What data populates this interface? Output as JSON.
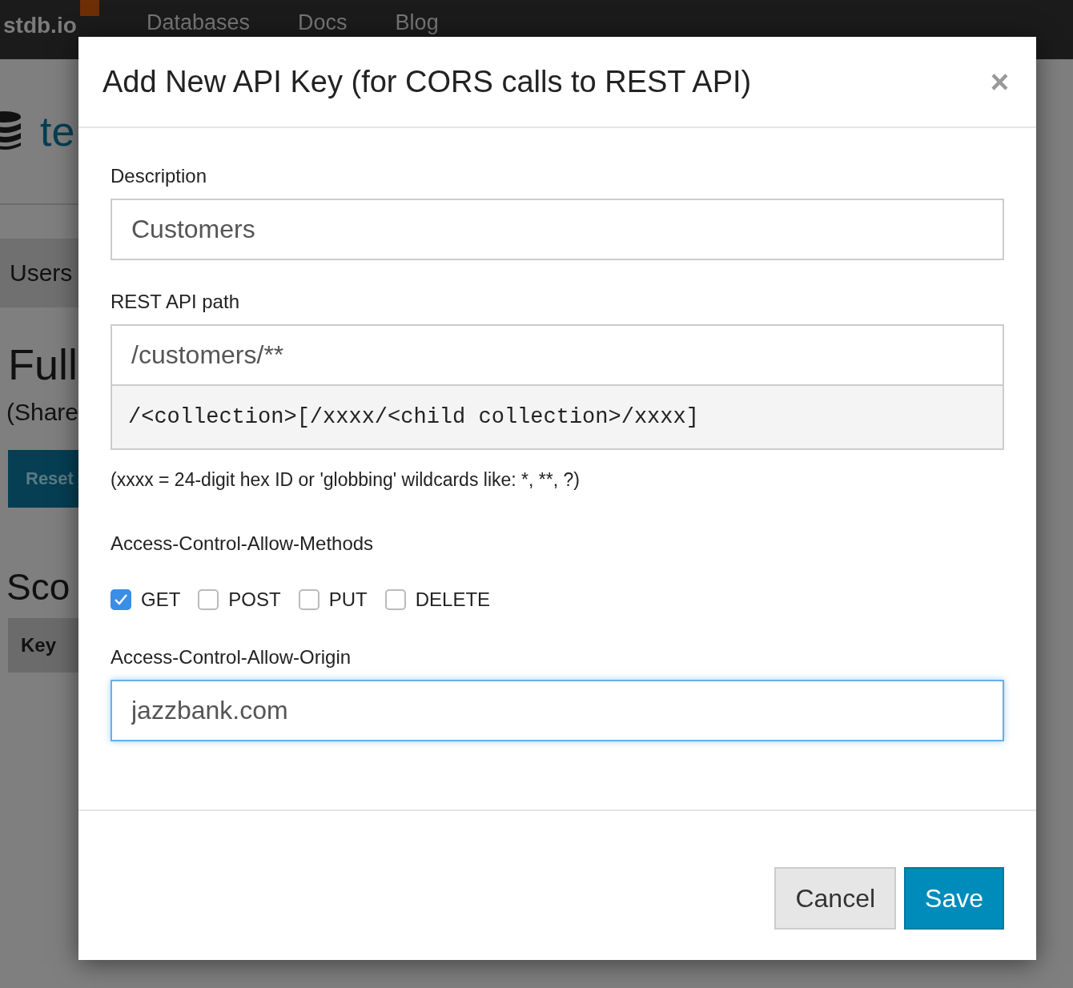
{
  "navbar": {
    "logo": "stdb.io",
    "links": [
      "Databases",
      "Docs",
      "Blog"
    ]
  },
  "background": {
    "heading": "te",
    "tab": "Users",
    "section_title": "Full",
    "section_note": "(Share",
    "button": "Reset",
    "section_title_2": "Sco",
    "table_header": "Key"
  },
  "dialog": {
    "title": "Add New API Key (for CORS calls to REST API)",
    "close": "×",
    "fields": [
      {
        "label": "Description",
        "value": "Customers",
        "focused": false
      },
      {
        "label": "REST API path",
        "value": "/customers/**",
        "focused": false,
        "hint": "/<collection>[/xxxx/<child collection>/xxxx]",
        "note": "(xxxx = 24-digit hex ID or 'globbing' wildcards like: *, **, ?)"
      }
    ],
    "methods_label": "Access-Control-Allow-Methods",
    "methods": [
      {
        "label": "GET",
        "checked": true
      },
      {
        "label": "POST",
        "checked": false
      },
      {
        "label": "PUT",
        "checked": false
      },
      {
        "label": "DELETE",
        "checked": false
      }
    ],
    "origin": {
      "label": "Access-Control-Allow-Origin",
      "value": "jazzbank.com",
      "focused": true
    },
    "buttons": [
      {
        "label": "Cancel",
        "kind": "default"
      },
      {
        "label": "Save",
        "kind": "primary"
      }
    ]
  }
}
